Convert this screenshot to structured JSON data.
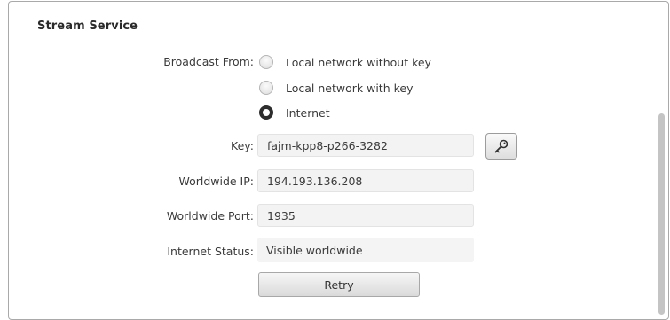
{
  "section": {
    "title": "Stream Service"
  },
  "broadcast_from": {
    "label": "Broadcast From:",
    "options": [
      {
        "label": "Local network without key",
        "selected": false
      },
      {
        "label": "Local network with key",
        "selected": false
      },
      {
        "label": "Internet",
        "selected": true
      }
    ]
  },
  "key": {
    "label": "Key:",
    "value": "fajm-kpp8-p266-3282",
    "button_icon": "key-icon"
  },
  "worldwide_ip": {
    "label": "Worldwide IP:",
    "value": "194.193.136.208"
  },
  "worldwide_port": {
    "label": "Worldwide Port:",
    "value": "1935"
  },
  "internet_status": {
    "label": "Internet Status:",
    "value": "Visible worldwide"
  },
  "actions": {
    "retry_label": "Retry"
  }
}
